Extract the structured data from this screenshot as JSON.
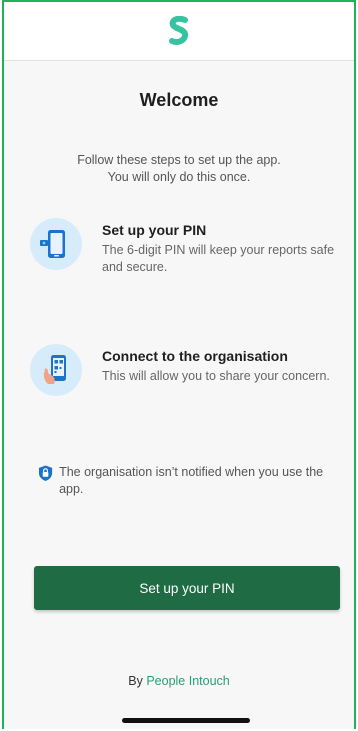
{
  "header": {
    "logo_icon": "app-logo-s-icon"
  },
  "main": {
    "title": "Welcome",
    "intro_line1": "Follow these steps to set up the app.",
    "intro_line2": "You will only do this once.",
    "steps": [
      {
        "icon": "phone-pin-icon",
        "title": "Set up your PIN",
        "description": "The 6-digit PIN will keep your reports safe and secure."
      },
      {
        "icon": "qr-scan-icon",
        "title": "Connect to the organisation",
        "description": "This will allow you to share your concern."
      }
    ],
    "notice": {
      "icon": "shield-lock-icon",
      "text": "The organisation isn’t notified when you use the app."
    },
    "cta_label": "Set up your PIN"
  },
  "footer": {
    "prefix": "By",
    "link_text": "People Intouch"
  },
  "colors": {
    "accent": "#1e6b44",
    "logo": "#37c2a0",
    "link": "#2a9d78",
    "icon_bg": "#d7ecfa",
    "frame": "#1db35a"
  }
}
